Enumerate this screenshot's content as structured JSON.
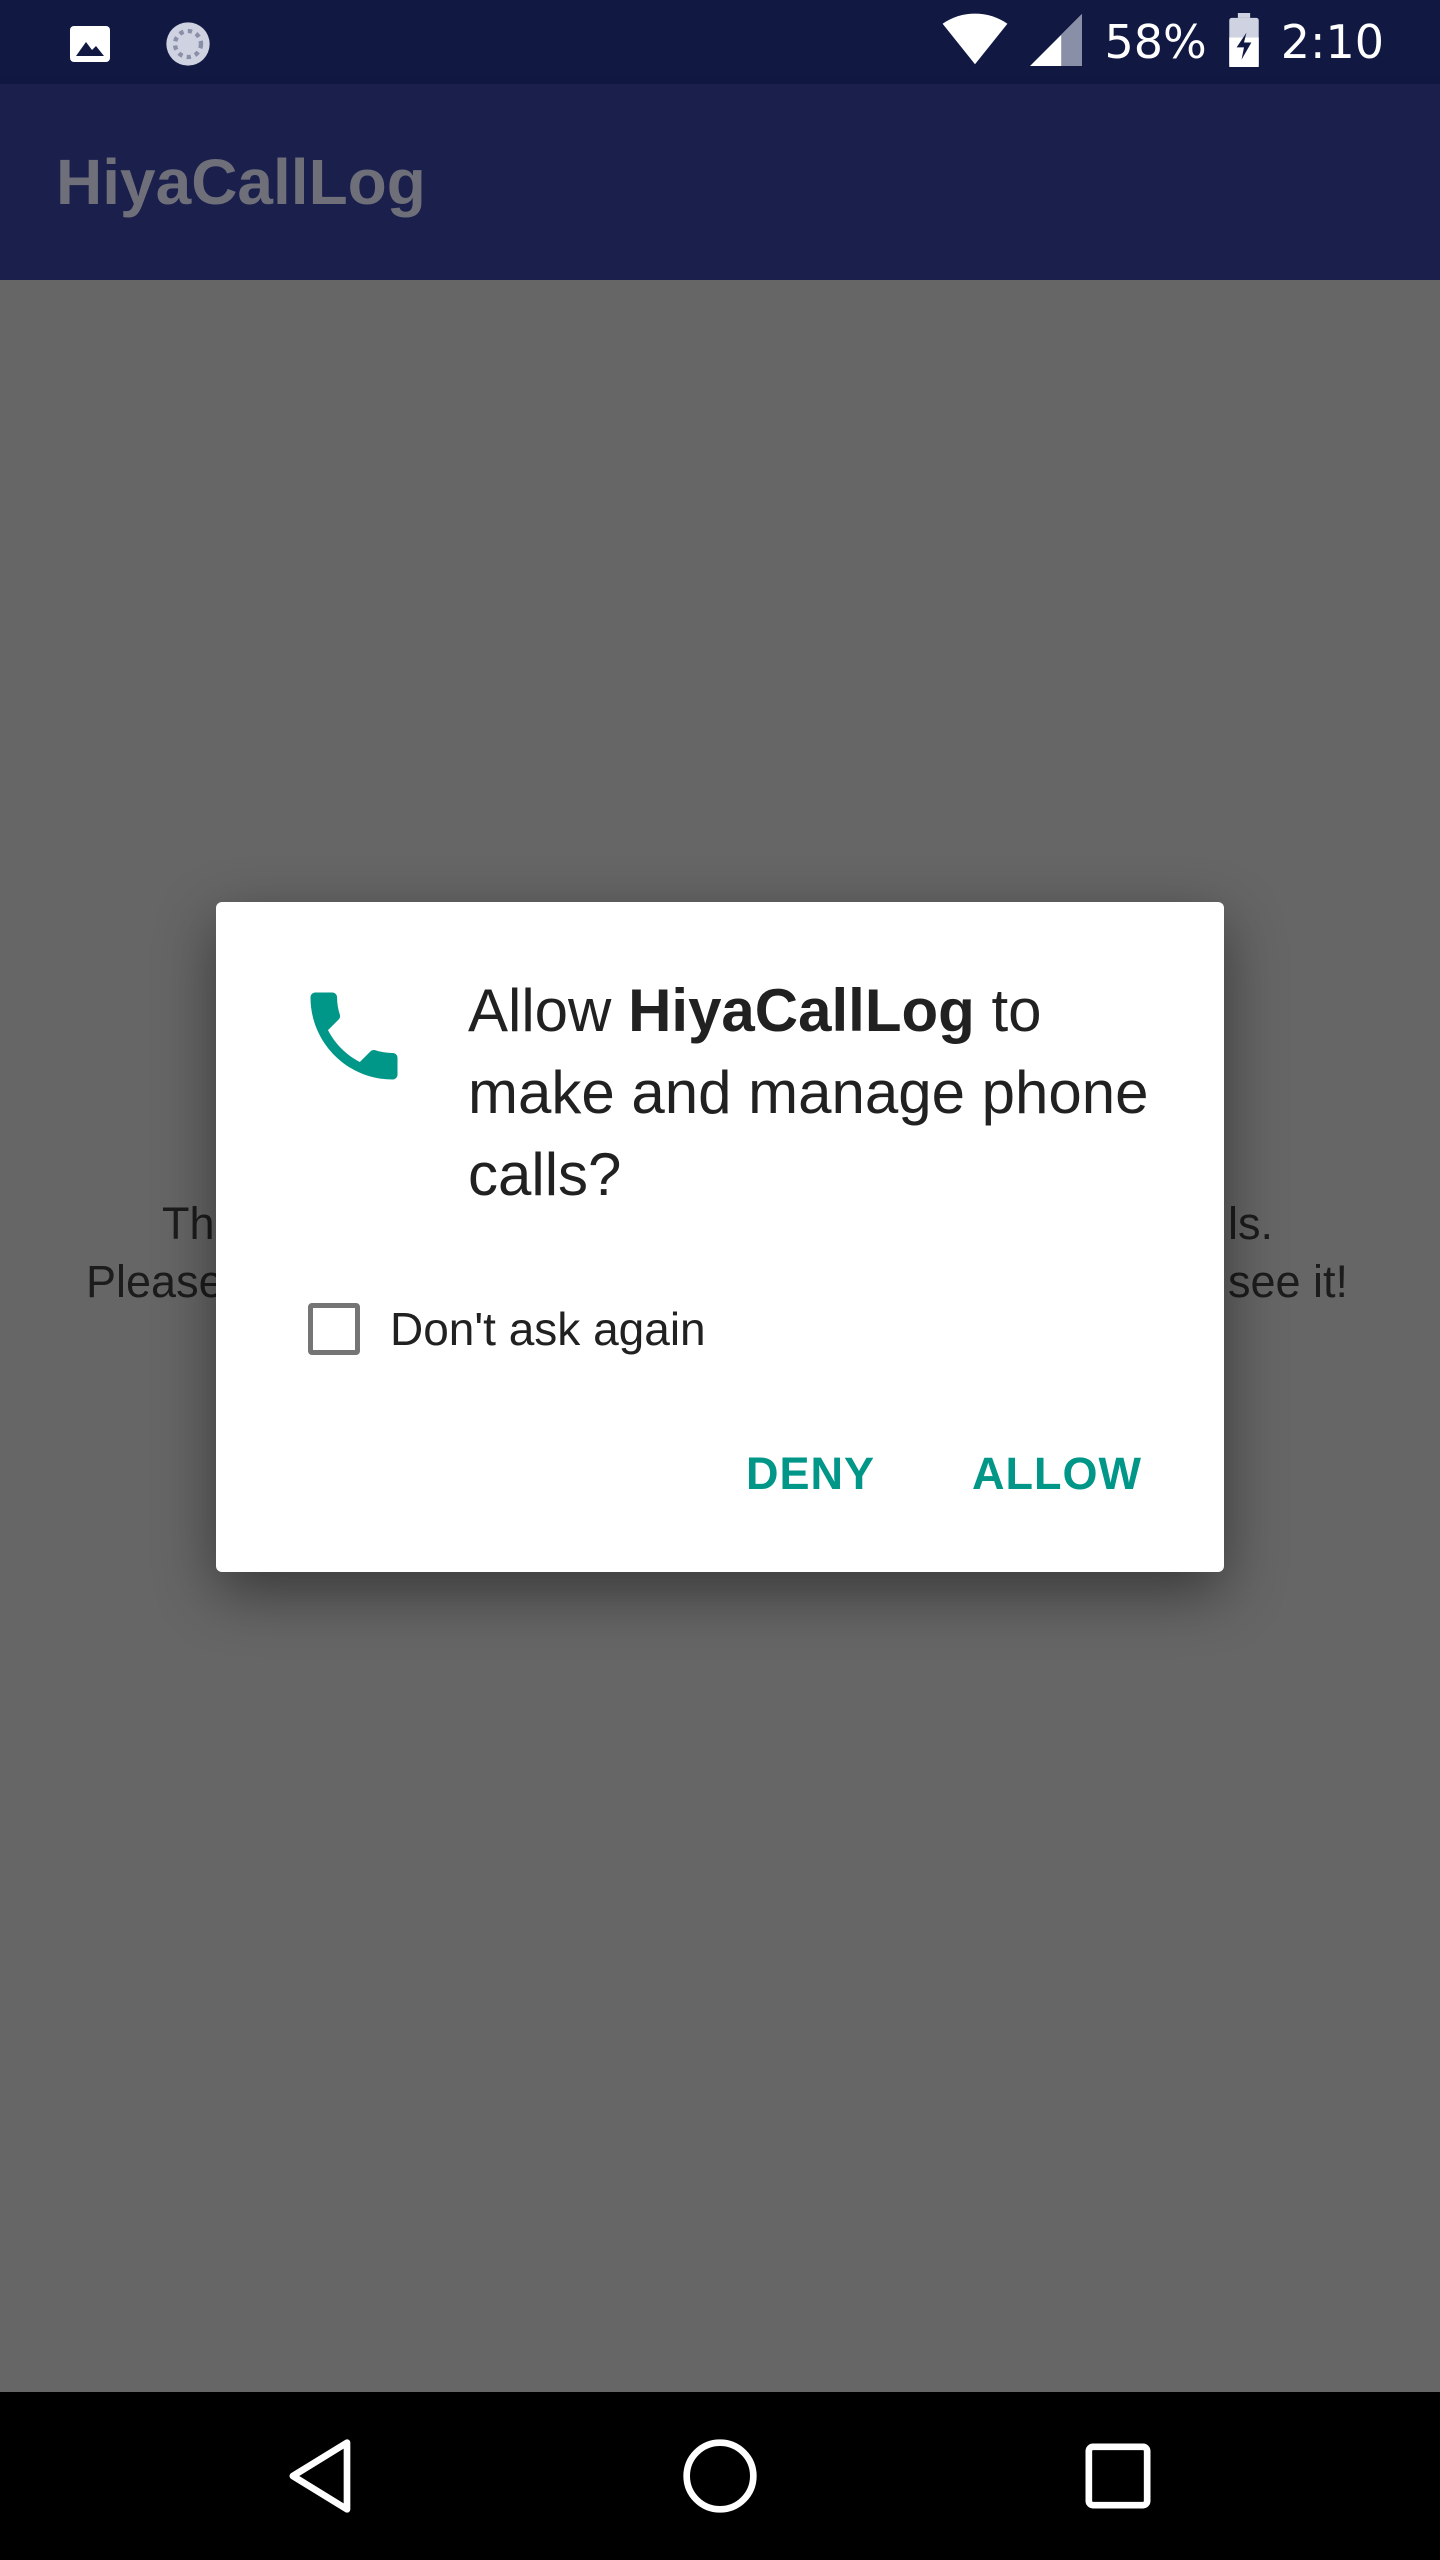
{
  "status_bar": {
    "battery_percent": "58%",
    "time": "2:10",
    "icons": [
      "image-icon",
      "sync-icon",
      "wifi-icon",
      "cell-signal-icon",
      "battery-icon"
    ]
  },
  "app_bar": {
    "title": "HiyaCallLog"
  },
  "background": {
    "line1_left": "Th",
    "line1_right": "ls.",
    "line2_left": "Please",
    "line2_right": "see it!"
  },
  "dialog": {
    "icon": "phone-icon",
    "title_prefix": "Allow ",
    "title_app": "HiyaCallLog",
    "title_suffix": " to make and manage phone calls?",
    "checkbox_label": "Don't ask again",
    "checkbox_checked": false,
    "deny_label": "DENY",
    "allow_label": "ALLOW",
    "accent_color": "#009688"
  },
  "nav_bar": {
    "icons": [
      "back-icon",
      "home-icon",
      "recents-icon"
    ]
  }
}
